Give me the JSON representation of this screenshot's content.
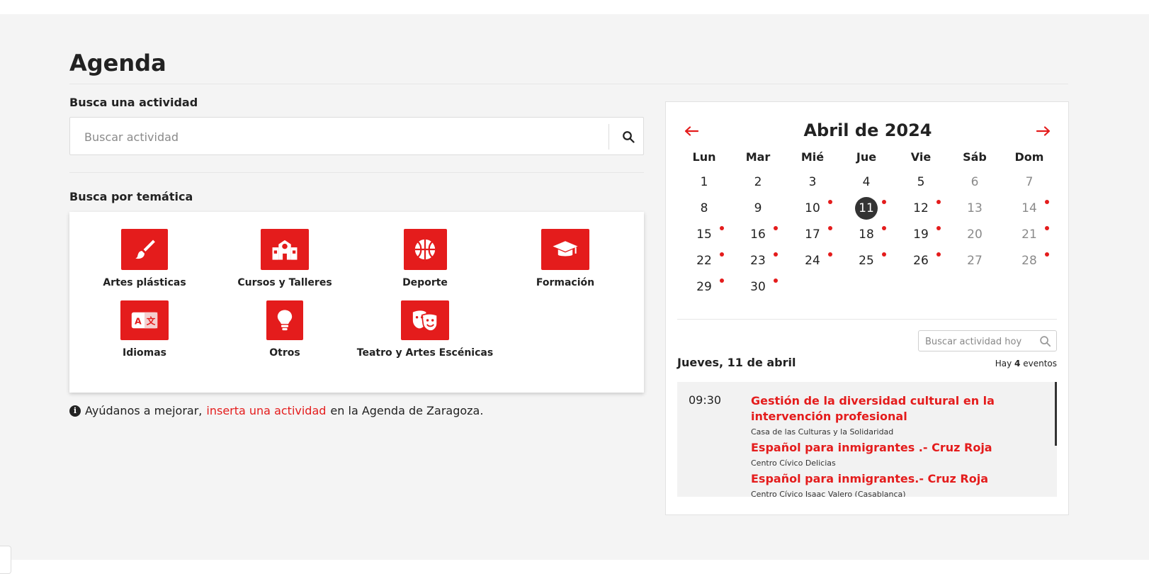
{
  "page": {
    "title": "Agenda"
  },
  "search": {
    "label": "Busca una actividad",
    "placeholder": "Buscar actividad",
    "value": ""
  },
  "themes": {
    "label": "Busca por temática",
    "items": [
      {
        "label": "Artes plásticas",
        "icon": "paintbrush-icon"
      },
      {
        "label": "Cursos y Talleres",
        "icon": "school-icon"
      },
      {
        "label": "Deporte",
        "icon": "basketball-icon"
      },
      {
        "label": "Formación",
        "icon": "graduation-cap-icon"
      },
      {
        "label": "Idiomas",
        "icon": "language-icon"
      },
      {
        "label": "Otros",
        "icon": "lightbulb-icon"
      },
      {
        "label": "Teatro y Artes Escénicas",
        "icon": "theater-masks-icon"
      }
    ]
  },
  "help": {
    "prefix": "Ayúdanos a mejorar,",
    "link": "inserta una actividad",
    "suffix": "en la Agenda de Zaragoza."
  },
  "calendar": {
    "month_title": "Abril de 2024",
    "weekdays": [
      "Lun",
      "Mar",
      "Mié",
      "Jue",
      "Vie",
      "Sáb",
      "Dom"
    ],
    "weeks": [
      [
        {
          "d": "1"
        },
        {
          "d": "2"
        },
        {
          "d": "3"
        },
        {
          "d": "4"
        },
        {
          "d": "5"
        },
        {
          "d": "6"
        },
        {
          "d": "7"
        }
      ],
      [
        {
          "d": "8"
        },
        {
          "d": "9"
        },
        {
          "d": "10",
          "e": true
        },
        {
          "d": "11",
          "e": true,
          "sel": true
        },
        {
          "d": "12",
          "e": true
        },
        {
          "d": "13"
        },
        {
          "d": "14",
          "e": true
        }
      ],
      [
        {
          "d": "15",
          "e": true
        },
        {
          "d": "16",
          "e": true
        },
        {
          "d": "17",
          "e": true
        },
        {
          "d": "18",
          "e": true
        },
        {
          "d": "19",
          "e": true
        },
        {
          "d": "20"
        },
        {
          "d": "21",
          "e": true
        }
      ],
      [
        {
          "d": "22",
          "e": true
        },
        {
          "d": "23",
          "e": true
        },
        {
          "d": "24",
          "e": true
        },
        {
          "d": "25",
          "e": true
        },
        {
          "d": "26",
          "e": true
        },
        {
          "d": "27"
        },
        {
          "d": "28",
          "e": true
        }
      ],
      [
        {
          "d": "29",
          "e": true
        },
        {
          "d": "30",
          "e": true
        }
      ]
    ]
  },
  "today": {
    "search_placeholder": "Buscar actividad hoy",
    "heading": "Jueves, 11 de abril",
    "count_prefix": "Hay",
    "count": "4",
    "count_suffix": "eventos",
    "time": "09:30",
    "events": [
      {
        "title": "Gestión de la diversidad cultural en la intervención profesional",
        "place": "Casa de las Culturas y la Solidaridad"
      },
      {
        "title": "Español para inmigrantes .- Cruz Roja",
        "place": "Centro Cívico Delicias"
      },
      {
        "title": "Español para inmigrantes.- Cruz Roja",
        "place": "Centro Cívico Isaac Valero (Casablanca)"
      }
    ]
  },
  "colors": {
    "accent": "#e41c1c",
    "background": "#f4f4f4",
    "selected_day": "#333333"
  }
}
